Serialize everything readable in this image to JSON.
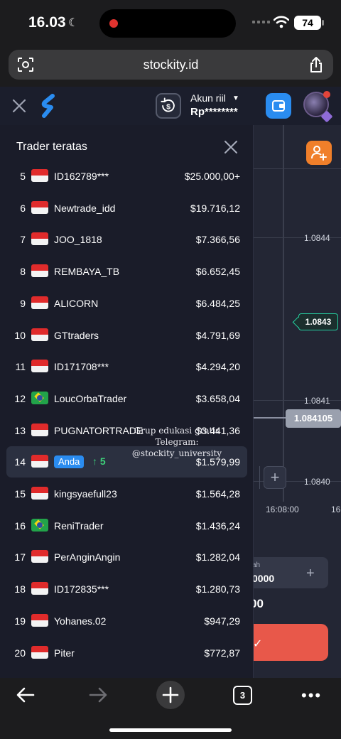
{
  "status_bar": {
    "time": "16.03",
    "battery": "74"
  },
  "browser": {
    "url": "stockity.id",
    "tabs_count": "3"
  },
  "header": {
    "account_label": "Akun riil",
    "account_balance": "Rp********"
  },
  "chart": {
    "price_ticks": [
      "1.0844",
      "1.0841",
      "1.0840"
    ],
    "current_price": "1.0843",
    "line_price": "1.084105",
    "time_ticks": [
      "16:08:00",
      "16"
    ]
  },
  "trade": {
    "amount_label": "ah",
    "amount_value": "0000",
    "payout": "00"
  },
  "leaderboard": {
    "title": "Trader teratas",
    "rows": [
      {
        "rank": "5",
        "country": "id",
        "name": "ID162789***",
        "amount": "$25.000,00+"
      },
      {
        "rank": "6",
        "country": "id",
        "name": "Newtrade_idd",
        "amount": "$19.716,12"
      },
      {
        "rank": "7",
        "country": "id",
        "name": "JOO_1818",
        "amount": "$7.366,56"
      },
      {
        "rank": "8",
        "country": "id",
        "name": "REMBAYA_TB",
        "amount": "$6.652,45"
      },
      {
        "rank": "9",
        "country": "id",
        "name": "ALICORN",
        "amount": "$6.484,25"
      },
      {
        "rank": "10",
        "country": "id",
        "name": "GTtraders",
        "amount": "$4.791,69"
      },
      {
        "rank": "11",
        "country": "id",
        "name": "ID171708***",
        "amount": "$4.294,20"
      },
      {
        "rank": "12",
        "country": "br",
        "name": "LoucOrbaTrader",
        "amount": "$3.658,04"
      },
      {
        "rank": "13",
        "country": "id",
        "name": "PUGNATORTRADE",
        "amount": "$3.441,36"
      },
      {
        "rank": "14",
        "country": "id",
        "name": "Anda",
        "amount": "$1.579,99",
        "rise": "5"
      },
      {
        "rank": "15",
        "country": "id",
        "name": "kingsyaefull23",
        "amount": "$1.564,28"
      },
      {
        "rank": "16",
        "country": "br",
        "name": "ReniTrader",
        "amount": "$1.436,24"
      },
      {
        "rank": "17",
        "country": "id",
        "name": "PerAnginAngin",
        "amount": "$1.282,04"
      },
      {
        "rank": "18",
        "country": "id",
        "name": "ID172835***",
        "amount": "$1.280,73"
      },
      {
        "rank": "19",
        "country": "id",
        "name": "Yohanes.02",
        "amount": "$947,29"
      },
      {
        "rank": "20",
        "country": "id",
        "name": "Piter",
        "amount": "$772,87"
      }
    ]
  },
  "watermark": {
    "line1": "Grup edukasi gratis",
    "line2": "Telegram: @stockity_university"
  },
  "colors": {
    "accent_blue": "#2a8cf0",
    "up_green": "#3ed17a",
    "sell_red": "#e8584a",
    "orange": "#f07f2a"
  }
}
